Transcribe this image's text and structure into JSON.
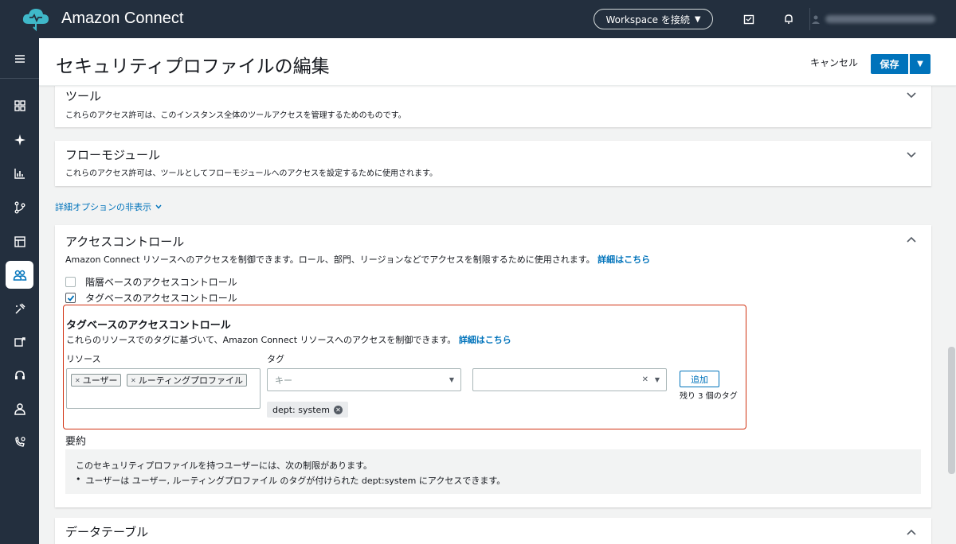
{
  "app": {
    "title": "Amazon Connect",
    "workspace_button": "Workspace を接続"
  },
  "header": {
    "title": "セキュリティプロファイルの編集",
    "cancel": "キャンセル",
    "save": "保存"
  },
  "sections": {
    "tools": {
      "title": "ツール",
      "desc": "これらのアクセス許可は、このインスタンス全体のツールアクセスを管理するためのものです。"
    },
    "flow_modules": {
      "title": "フローモジュール",
      "desc": "これらのアクセス許可は、ツールとしてフローモジュールへのアクセスを設定するために使用されます。"
    },
    "advanced_toggle": "詳細オプションの非表示",
    "access_control": {
      "title": "アクセスコントロール",
      "desc": "Amazon Connect リソースへのアクセスを制御できます。ロール、部門、リージョンなどでアクセスを制限するために使用されます。",
      "learn_more": "詳細はこちら",
      "options": [
        {
          "label": "階層ベースのアクセスコントロール",
          "checked": false
        },
        {
          "label": "タグベースのアクセスコントロール",
          "checked": true
        }
      ],
      "tag_based": {
        "title": "タグベースのアクセスコントロール",
        "desc": "これらのリソースでのタグに基づいて、Amazon Connect リソースへのアクセスを制御できます。",
        "learn_more": "詳細はこちら",
        "resource_label": "リソース",
        "tag_label": "タグ",
        "resources": [
          "ユーザー",
          "ルーティングプロファイル"
        ],
        "key_placeholder": "キー",
        "add_button": "追加",
        "remaining": "残り 3 個のタグ",
        "tag_chip": "dept: system"
      },
      "summary": {
        "title": "要約",
        "line1": "このセキュリティプロファイルを持つユーザーには、次の制限があります。",
        "line2": "ユーザーは ユーザー, ルーティングプロファイル のタグが付けられた dept:system にアクセスできます。"
      }
    },
    "data_tables": {
      "title": "データテーブル"
    }
  },
  "colors": {
    "topbar": "#232f3e",
    "primary": "#0073bb",
    "highlight_border": "#d13212"
  }
}
